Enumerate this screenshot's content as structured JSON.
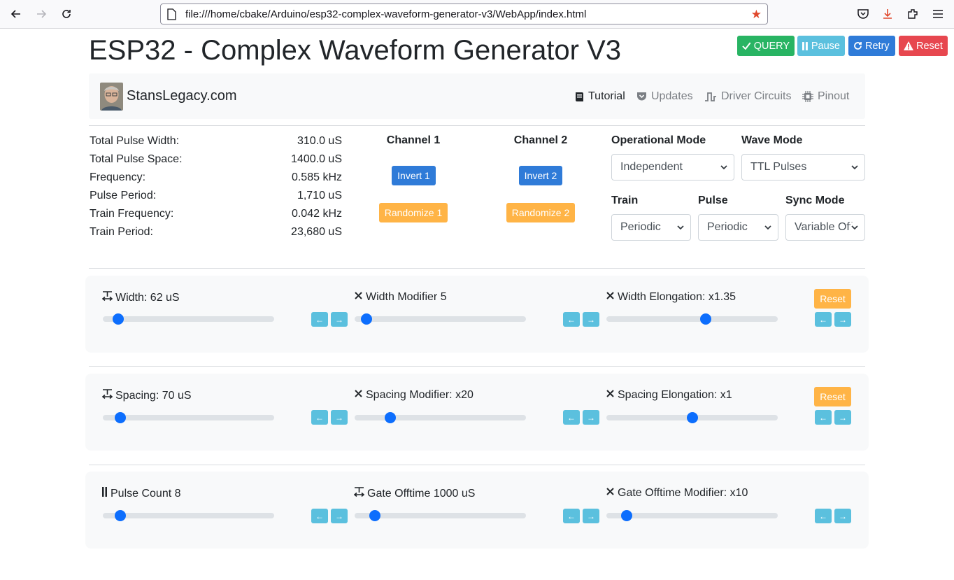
{
  "browser": {
    "url": "file:///home/cbake/Arduino/esp32-complex-waveform-generator-v3/WebApp/index.html"
  },
  "title": "ESP32 - Complex Waveform Generator V3",
  "top_buttons": {
    "query": "QUERY",
    "pause": "Pause",
    "retry": "Retry",
    "reset": "Reset"
  },
  "navbar": {
    "brand": "StansLegacy.com",
    "links": {
      "tutorial": "Tutorial",
      "updates": "Updates",
      "driver_circuits": "Driver Circuits",
      "pinout": "Pinout"
    }
  },
  "stats": [
    {
      "label": "Total Pulse Width:",
      "value": "310.0 uS"
    },
    {
      "label": "Total Pulse Space:",
      "value": "1400.0 uS"
    },
    {
      "label": "Frequency:",
      "value": "0.585 kHz"
    },
    {
      "label": "Pulse Period:",
      "value": "1,710 uS"
    },
    {
      "label": "Train Frequency:",
      "value": "0.042 kHz"
    },
    {
      "label": "Train Period:",
      "value": "23,680 uS"
    }
  ],
  "channels": [
    {
      "title": "Channel 1",
      "invert": "Invert 1",
      "randomize": "Randomize 1"
    },
    {
      "title": "Channel 2",
      "invert": "Invert 2",
      "randomize": "Randomize 2"
    }
  ],
  "selects": {
    "operational_mode": {
      "label": "Operational Mode",
      "value": "Independent"
    },
    "wave_mode": {
      "label": "Wave Mode",
      "value": "TTL Pulses"
    },
    "train": {
      "label": "Train",
      "value": "Periodic"
    },
    "pulse": {
      "label": "Pulse",
      "value": "Periodic"
    },
    "sync_mode": {
      "label": "Sync Mode",
      "value": "Variable Off"
    }
  },
  "panels": {
    "width": {
      "reset": "Reset",
      "sliders": [
        {
          "label": "Width: 62 uS",
          "level": 0.09,
          "icon": "width-icon"
        },
        {
          "label": "Width Modifier 5",
          "level": 0.07,
          "icon": "times-icon"
        },
        {
          "label": "Width Elongation: x1.35",
          "level": 0.58,
          "icon": "times-icon"
        }
      ]
    },
    "spacing": {
      "reset": "Reset",
      "sliders": [
        {
          "label": "Spacing: 70 uS",
          "level": 0.1,
          "icon": "width-icon"
        },
        {
          "label": "Spacing Modifier: x20",
          "level": 0.21,
          "icon": "times-icon"
        },
        {
          "label": "Spacing Elongation: x1",
          "level": 0.5,
          "icon": "times-icon"
        }
      ]
    },
    "gate": {
      "sliders": [
        {
          "label": "Pulse Count 8",
          "level": 0.1,
          "icon": "pause-icon"
        },
        {
          "label": "Gate Offtime 1000 uS",
          "level": 0.12,
          "icon": "width-icon"
        },
        {
          "label": "Gate Offtime Modifier: x10",
          "level": 0.12,
          "icon": "times-icon"
        }
      ]
    }
  },
  "colors": {
    "primary": "#0d6efd",
    "info": "#5bc0de",
    "warning": "#ffb446",
    "success": "#28b463",
    "danger": "#e7474f"
  }
}
